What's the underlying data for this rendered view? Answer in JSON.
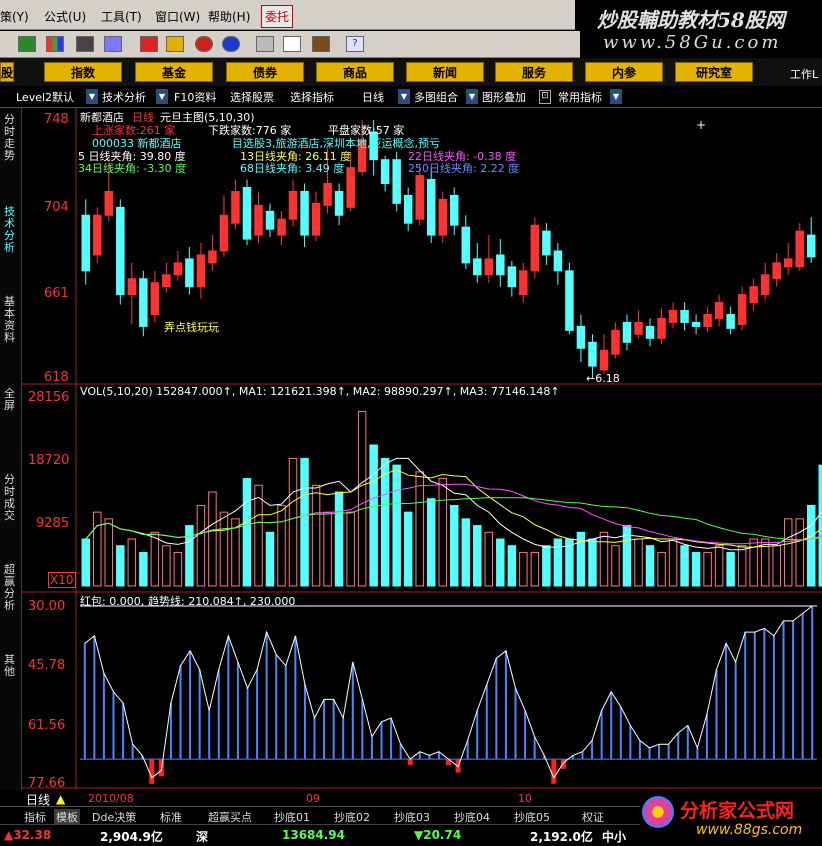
{
  "menu": {
    "items": [
      "策(Y)",
      "公式(U)",
      "工具(T)",
      "窗口(W)",
      "帮助(H)",
      "委托"
    ],
    "watermark_top": "炒股輔助教材58股网",
    "watermark_url": "www.58Gu.com"
  },
  "toolbar": {
    "icons": [
      "column-icon",
      "bars-icon",
      "binoculars-icon",
      "alarm-icon",
      "stop-icon",
      "diamond-icon",
      "no-icon",
      "euro-icon",
      "eraser-icon",
      "window-icon",
      "books-icon",
      "help-icon"
    ]
  },
  "main_tabs": [
    "股",
    "指数",
    "基金",
    "债券",
    "商品",
    "新闻",
    "服务",
    "内参",
    "研究室",
    "工作L"
  ],
  "indicator_toolbar": {
    "items": [
      "Level2默认",
      "技术分析",
      "F10资料",
      "选择股票",
      "选择指标",
      "日线",
      "多图组合",
      "图形叠加",
      "常用指标"
    ]
  },
  "sidebar": {
    "tabs": [
      "分时走势",
      "技术分析",
      "基本资料",
      "全屏",
      "分时成交",
      "超赢分析",
      "其他"
    ]
  },
  "price_panel": {
    "title_name": "新都酒店",
    "title_period": "日线",
    "title_main": "元旦主图(5,10,30)",
    "up_count": "上涨家数:261 家",
    "down_count": "下跌家数:776 家",
    "flat_count": "平盘家数:57 家",
    "code_line": "000033 新都酒店",
    "concept_line": "目选股3,旅游酒店,深圳本地,亚运概念,预亏",
    "angle5": "5 日线夹角: 39.80 度",
    "angle13": "13日线夹角: 26.11 度",
    "angle22": "22日线夹角: -0.38 度",
    "angle34": "34日线夹角: -3.30 度",
    "angle68": "68日线夹角: 3.49 度",
    "angle250": "250日线夹角: 2.22 度",
    "note": "弄点钱玩玩",
    "low_marker": "6.18",
    "y_labels": [
      "748",
      "704",
      "661",
      "618"
    ]
  },
  "volume_panel": {
    "header": "VOL(5,10,20) 152847.000↑, MA1: 121621.398↑, MA2: 98890.297↑, MA3: 77146.148↑",
    "y_labels": [
      "28156",
      "18720",
      "9285",
      "X10"
    ]
  },
  "red_panel": {
    "header_a": "红包: 0.000,",
    "header_b": "趋势线: 210.084↑, 230.000",
    "y_labels": [
      "30.00",
      "45.78",
      "61.56",
      "77.66"
    ]
  },
  "x_axis": {
    "period_label": "日线",
    "labels": [
      "2010/08",
      "09",
      "10"
    ]
  },
  "bottom_tabs": [
    "指标",
    "模板",
    "Dde决策",
    "标准",
    "超赢买点",
    "抄底01",
    "抄底02",
    "抄底03",
    "抄底04",
    "抄底05",
    "权证"
  ],
  "status": {
    "v1": "▲32.38",
    "v2": "2,904.9亿",
    "v3": "深",
    "v4": "13684.94",
    "v5": "▼20.74",
    "v6": "2,192.0亿",
    "v7": "中小"
  },
  "watermark_bottom": {
    "title": "分析家公式网",
    "url": "www.88gs.com"
  },
  "colors": {
    "up": "#ff3232",
    "down": "#54ffff",
    "gold": "#e4b200",
    "blue_bar": "#4a86ff",
    "axis_red": "#ff3030"
  },
  "chart_data": {
    "type": "candlestick",
    "ylim": [
      618,
      748
    ],
    "candles": [
      {
        "o": 700,
        "c": 672,
        "h": 708,
        "l": 665
      },
      {
        "o": 680,
        "c": 700,
        "h": 704,
        "l": 676
      },
      {
        "o": 700,
        "c": 712,
        "h": 726,
        "l": 697
      },
      {
        "o": 704,
        "c": 660,
        "h": 708,
        "l": 655
      },
      {
        "o": 660,
        "c": 668,
        "h": 676,
        "l": 645
      },
      {
        "o": 668,
        "c": 644,
        "h": 672,
        "l": 639
      },
      {
        "o": 650,
        "c": 666,
        "h": 672,
        "l": 646
      },
      {
        "o": 664,
        "c": 670,
        "h": 676,
        "l": 661
      },
      {
        "o": 670,
        "c": 676,
        "h": 682,
        "l": 667
      },
      {
        "o": 678,
        "c": 664,
        "h": 684,
        "l": 660
      },
      {
        "o": 664,
        "c": 680,
        "h": 686,
        "l": 658
      },
      {
        "o": 676,
        "c": 682,
        "h": 690,
        "l": 672
      },
      {
        "o": 682,
        "c": 700,
        "h": 710,
        "l": 679
      },
      {
        "o": 696,
        "c": 712,
        "h": 718,
        "l": 693
      },
      {
        "o": 714,
        "c": 688,
        "h": 718,
        "l": 685
      },
      {
        "o": 690,
        "c": 705,
        "h": 712,
        "l": 686
      },
      {
        "o": 702,
        "c": 693,
        "h": 706,
        "l": 689
      },
      {
        "o": 690,
        "c": 698,
        "h": 702,
        "l": 685
      },
      {
        "o": 698,
        "c": 712,
        "h": 718,
        "l": 694
      },
      {
        "o": 712,
        "c": 690,
        "h": 716,
        "l": 684
      },
      {
        "o": 690,
        "c": 706,
        "h": 712,
        "l": 687
      },
      {
        "o": 705,
        "c": 716,
        "h": 734,
        "l": 701
      },
      {
        "o": 712,
        "c": 700,
        "h": 716,
        "l": 695
      },
      {
        "o": 704,
        "c": 724,
        "h": 732,
        "l": 702
      },
      {
        "o": 722,
        "c": 738,
        "h": 748,
        "l": 720
      },
      {
        "o": 742,
        "c": 728,
        "h": 748,
        "l": 720
      },
      {
        "o": 728,
        "c": 716,
        "h": 730,
        "l": 712
      },
      {
        "o": 728,
        "c": 706,
        "h": 732,
        "l": 702
      },
      {
        "o": 710,
        "c": 696,
        "h": 714,
        "l": 692
      },
      {
        "o": 698,
        "c": 720,
        "h": 726,
        "l": 695
      },
      {
        "o": 718,
        "c": 690,
        "h": 724,
        "l": 686
      },
      {
        "o": 690,
        "c": 708,
        "h": 712,
        "l": 686
      },
      {
        "o": 710,
        "c": 695,
        "h": 714,
        "l": 690
      },
      {
        "o": 694,
        "c": 676,
        "h": 700,
        "l": 673
      },
      {
        "o": 678,
        "c": 670,
        "h": 686,
        "l": 666
      },
      {
        "o": 670,
        "c": 678,
        "h": 690,
        "l": 666
      },
      {
        "o": 680,
        "c": 670,
        "h": 688,
        "l": 664
      },
      {
        "o": 674,
        "c": 664,
        "h": 677,
        "l": 659
      },
      {
        "o": 660,
        "c": 672,
        "h": 676,
        "l": 656
      },
      {
        "o": 672,
        "c": 695,
        "h": 699,
        "l": 668
      },
      {
        "o": 692,
        "c": 680,
        "h": 696,
        "l": 675
      },
      {
        "o": 682,
        "c": 672,
        "h": 686,
        "l": 665
      },
      {
        "o": 672,
        "c": 642,
        "h": 676,
        "l": 640
      },
      {
        "o": 644,
        "c": 633,
        "h": 650,
        "l": 626
      },
      {
        "o": 636,
        "c": 624,
        "h": 640,
        "l": 618
      },
      {
        "o": 622,
        "c": 632,
        "h": 640,
        "l": 620
      },
      {
        "o": 630,
        "c": 642,
        "h": 646,
        "l": 628
      },
      {
        "o": 646,
        "c": 636,
        "h": 650,
        "l": 632
      },
      {
        "o": 640,
        "c": 646,
        "h": 652,
        "l": 638
      },
      {
        "o": 644,
        "c": 638,
        "h": 648,
        "l": 634
      },
      {
        "o": 638,
        "c": 648,
        "h": 653,
        "l": 635
      },
      {
        "o": 646,
        "c": 652,
        "h": 656,
        "l": 643
      },
      {
        "o": 652,
        "c": 646,
        "h": 656,
        "l": 642
      },
      {
        "o": 646,
        "c": 644,
        "h": 650,
        "l": 640
      },
      {
        "o": 644,
        "c": 650,
        "h": 654,
        "l": 641
      },
      {
        "o": 648,
        "c": 656,
        "h": 660,
        "l": 644
      },
      {
        "o": 650,
        "c": 643,
        "h": 654,
        "l": 640
      },
      {
        "o": 645,
        "c": 660,
        "h": 664,
        "l": 642
      },
      {
        "o": 656,
        "c": 664,
        "h": 668,
        "l": 652
      },
      {
        "o": 660,
        "c": 670,
        "h": 676,
        "l": 657
      },
      {
        "o": 668,
        "c": 676,
        "h": 681,
        "l": 664
      },
      {
        "o": 674,
        "c": 678,
        "h": 686,
        "l": 670
      },
      {
        "o": 674,
        "c": 692,
        "h": 696,
        "l": 672
      },
      {
        "o": 690,
        "c": 679,
        "h": 699,
        "l": 676
      }
    ],
    "volume": [
      7,
      11,
      10,
      6,
      7,
      5,
      8,
      6,
      5,
      9,
      12,
      14,
      11,
      10,
      16,
      15,
      8,
      12,
      19,
      19,
      15,
      11,
      14,
      11,
      26,
      21,
      19,
      18,
      11,
      17,
      13,
      16,
      12,
      10,
      9,
      8,
      7,
      6,
      5,
      5,
      6,
      7,
      7,
      8,
      7,
      8,
      6,
      9,
      7,
      6,
      5,
      7,
      6,
      5,
      5,
      6,
      5,
      6,
      7,
      7,
      6,
      10,
      10,
      12,
      18
    ],
    "red": [
      40,
      38,
      48,
      53,
      56,
      67,
      70,
      76,
      74,
      56,
      46,
      42,
      47,
      58,
      47,
      38,
      45,
      52,
      47,
      37,
      43,
      46,
      38,
      51,
      60,
      55,
      55,
      60,
      45,
      55,
      65,
      61,
      60,
      67,
      71,
      69,
      70,
      69,
      71,
      73,
      66,
      58,
      51,
      44,
      42,
      52,
      58,
      65,
      70,
      76,
      72,
      70,
      69,
      66,
      58,
      53,
      57,
      62,
      66,
      68,
      67,
      67,
      64,
      62,
      68,
      59,
      47,
      40,
      45,
      37,
      37,
      36,
      38,
      34,
      34,
      32,
      30
    ]
  }
}
